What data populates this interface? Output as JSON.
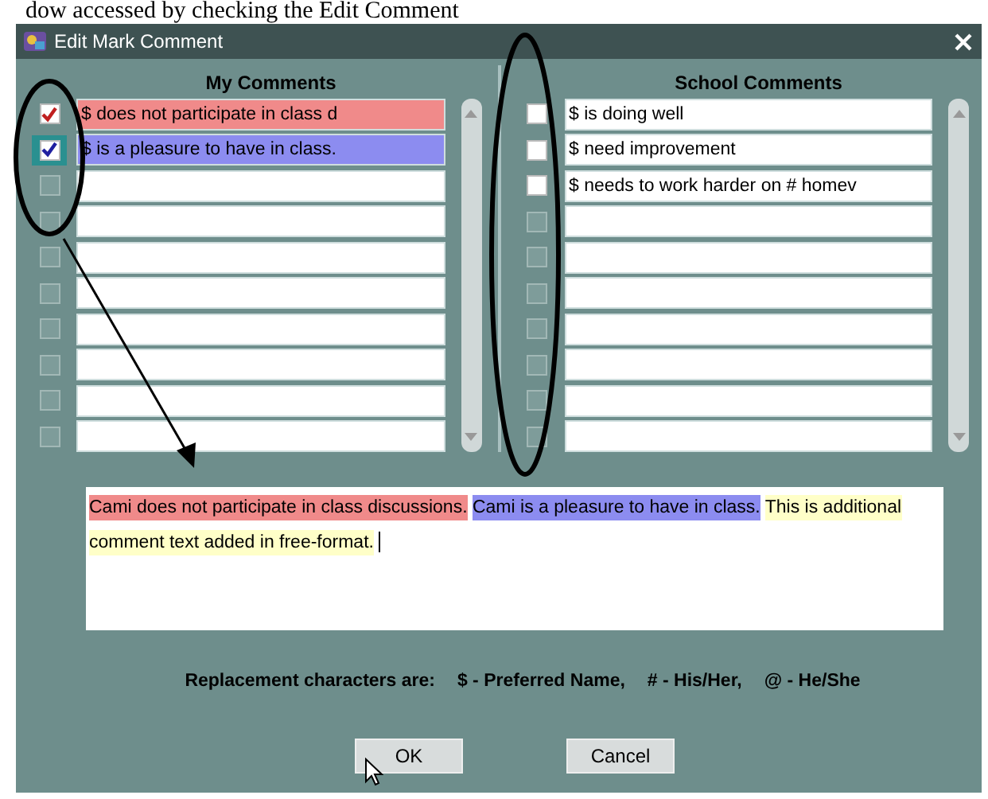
{
  "document_line": "dow accessed by checking the Edit Comment",
  "window": {
    "title": "Edit Mark Comment"
  },
  "my_comments": {
    "heading": "My Comments",
    "rows": [
      {
        "text": "$ does not participate in class d",
        "checked": true,
        "disabled": false,
        "color": "#f08a8a"
      },
      {
        "text": "$ is a pleasure to have in class.",
        "checked": true,
        "disabled": false,
        "color": "#8c8cf0"
      },
      {
        "checked": false,
        "disabled": true
      },
      {
        "checked": false,
        "disabled": true
      },
      {
        "checked": false,
        "disabled": true
      },
      {
        "checked": false,
        "disabled": true
      },
      {
        "checked": false,
        "disabled": true
      },
      {
        "checked": false,
        "disabled": true
      },
      {
        "checked": false,
        "disabled": true
      },
      {
        "checked": false,
        "disabled": true
      }
    ]
  },
  "school_comments": {
    "heading": "School Comments",
    "rows": [
      {
        "text": "$ is doing well",
        "checked": false,
        "disabled": false
      },
      {
        "text": "$ need improvement",
        "checked": false,
        "disabled": false
      },
      {
        "text": "$ needs to work harder on # homev",
        "checked": false,
        "disabled": false
      },
      {
        "checked": false,
        "disabled": true
      },
      {
        "checked": false,
        "disabled": true
      },
      {
        "checked": false,
        "disabled": true
      },
      {
        "checked": false,
        "disabled": true
      },
      {
        "checked": false,
        "disabled": true
      },
      {
        "checked": false,
        "disabled": true
      },
      {
        "checked": false,
        "disabled": true
      }
    ]
  },
  "comment_text": [
    {
      "text": "Cami does not participate in class discussions.",
      "color": "#f08a8a"
    },
    {
      "text": "Cami is a pleasure to have in class.",
      "color": "#8c8cf0"
    },
    {
      "text": "This is additional comment text added in free-format.",
      "color": "#ffffc8"
    }
  ],
  "replacement": {
    "label": "Replacement characters are:",
    "items": [
      "$ - Preferred Name,",
      "# - His/Her,",
      "@ - He/She"
    ]
  },
  "buttons": [
    "OK",
    "Cancel"
  ]
}
